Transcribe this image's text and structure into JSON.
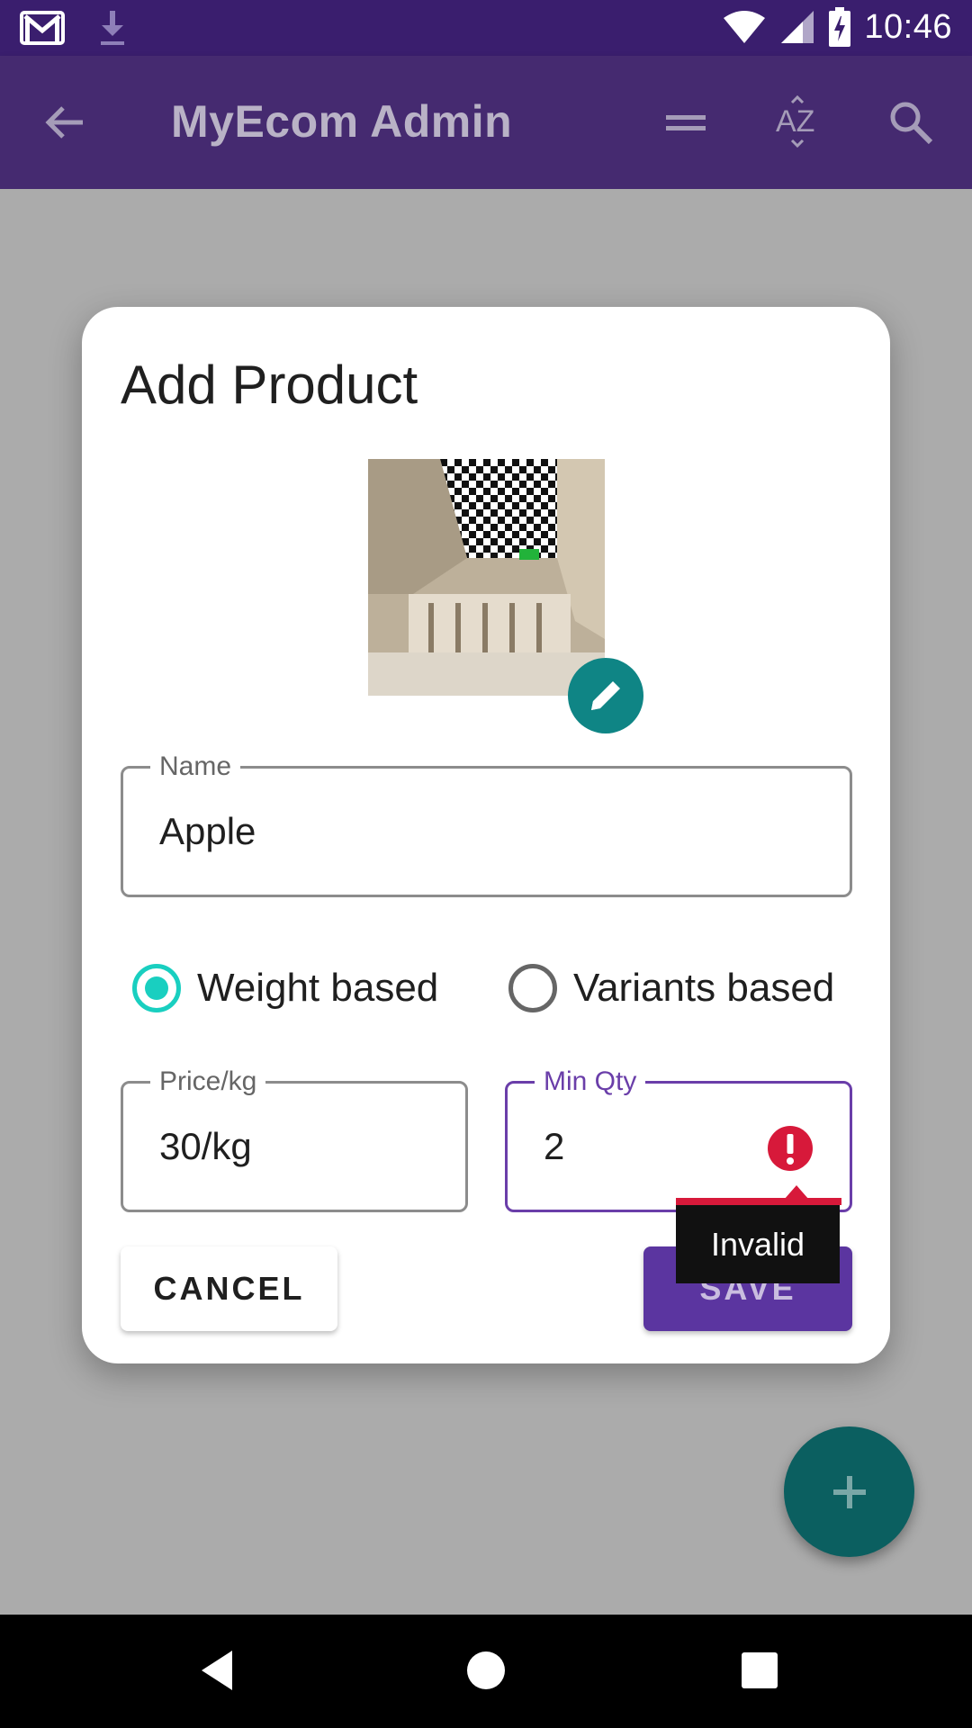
{
  "status_bar": {
    "time": "10:46",
    "icons": [
      "gmail-icon",
      "download-icon",
      "wifi-icon",
      "signal-icon",
      "battery-charging-icon"
    ]
  },
  "app_bar": {
    "title": "MyEcom Admin",
    "icons": [
      "back-arrow-icon",
      "menu-lines-icon",
      "sort-az-icon",
      "search-icon"
    ]
  },
  "dialog": {
    "title": "Add Product",
    "image_edit_icon": "pencil-icon",
    "name_field": {
      "label": "Name",
      "value": "Apple"
    },
    "radio_options": [
      {
        "label": "Weight based",
        "checked": true
      },
      {
        "label": "Variants based",
        "checked": false
      }
    ],
    "price_field": {
      "label": "Price/kg",
      "value": "30/kg"
    },
    "min_qty_field": {
      "label": "Min Qty",
      "value": "2",
      "error_tooltip": "Invalid"
    },
    "cancel_label": "CANCEL",
    "save_label": "SAVE"
  },
  "fab": {
    "icon": "plus-icon"
  },
  "nav_bar": {
    "icons": [
      "nav-back-icon",
      "nav-home-icon",
      "nav-recent-icon"
    ]
  },
  "colors": {
    "primary": "#5b35a0",
    "accent": "#19cfc0",
    "error": "#d7193a",
    "fab": "#0b5f60"
  }
}
